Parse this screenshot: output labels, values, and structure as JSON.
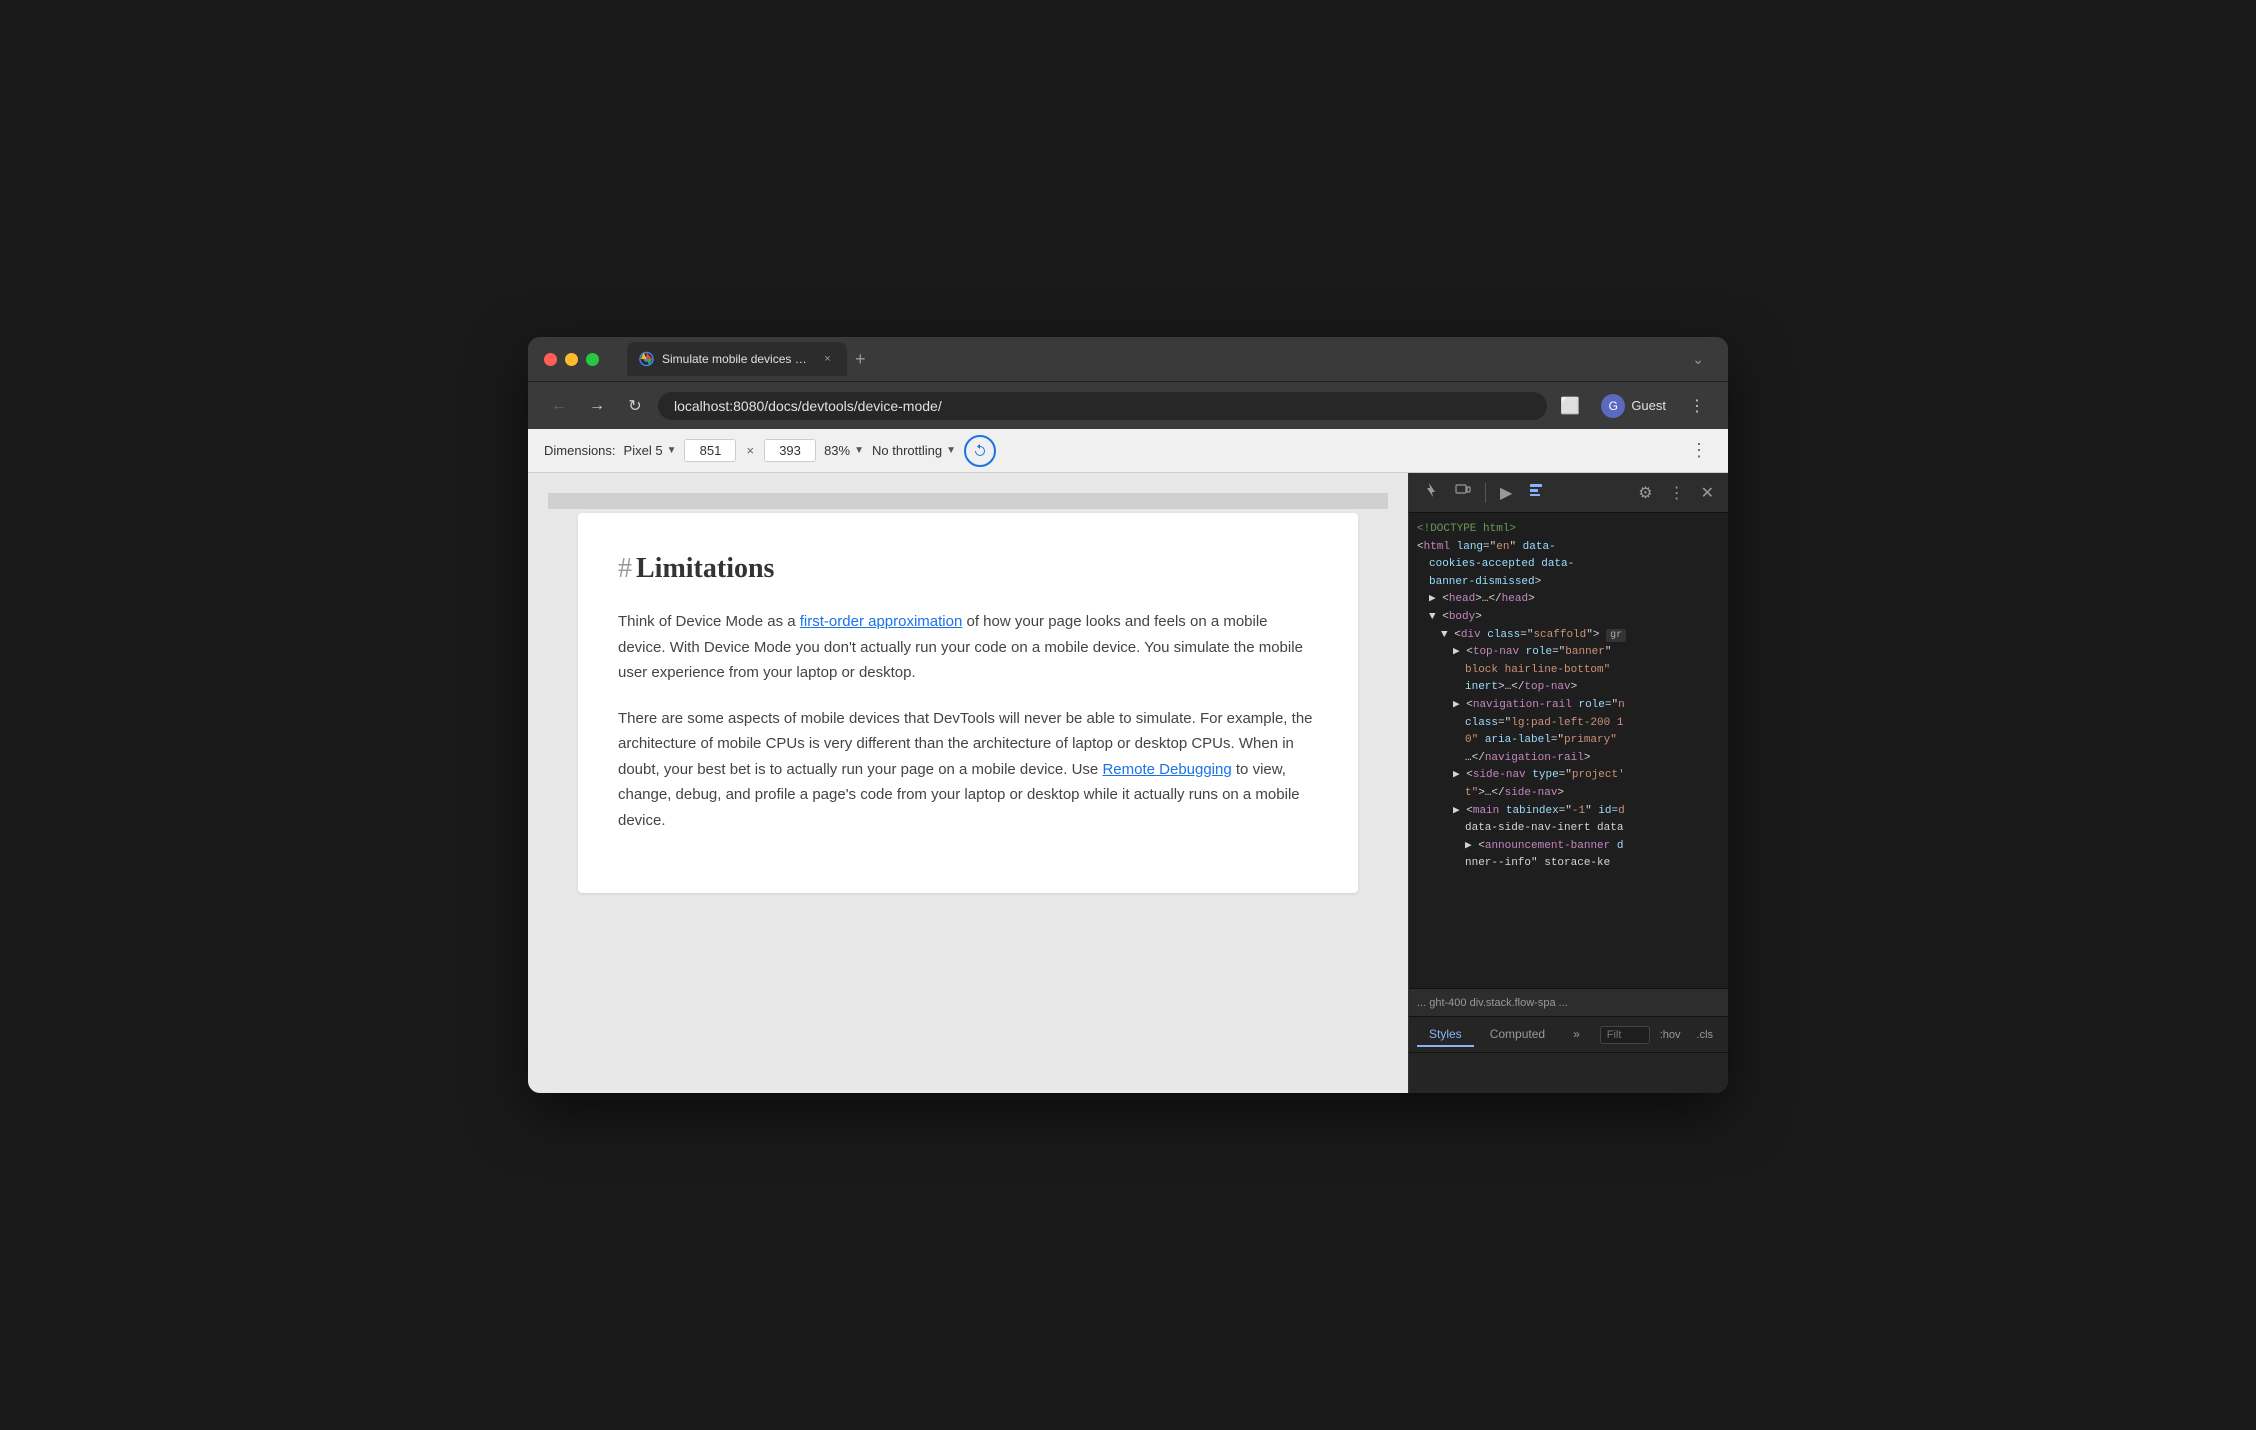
{
  "window": {
    "title": "Simulate mobile devices with D",
    "url": "localhost:8080/docs/devtools/device-mode/"
  },
  "traffic_lights": {
    "close": "close",
    "minimize": "minimize",
    "maximize": "maximize"
  },
  "tab": {
    "title": "Simulate mobile devices with D",
    "close_label": "×"
  },
  "new_tab_label": "+",
  "nav": {
    "back_label": "←",
    "forward_label": "→",
    "reload_label": "↻",
    "address": "localhost:8080/docs/devtools/device-mode/",
    "cast_label": "⬜",
    "profile_label": "Guest",
    "more_label": "⋮"
  },
  "device_toolbar": {
    "dimensions_label": "Dimensions:",
    "device_name": "Pixel 5",
    "width": "851",
    "height": "393",
    "zoom": "83%",
    "throttle": "No throttling",
    "rotate_label": "⤢",
    "more_label": "⋮"
  },
  "page": {
    "heading_hash": "#",
    "heading": "Limitations",
    "paragraph1_before_link": "Think of Device Mode as a ",
    "paragraph1_link": "first-order approximation",
    "paragraph1_after_link": " of how your page looks and feels on a mobile device. With Device Mode you don't actually run your code on a mobile device. You simulate the mobile user experience from your laptop or desktop.",
    "paragraph2_before_link": "There are some aspects of mobile devices that DevTools will never be able to simulate. For example, the architecture of mobile CPUs is very different than the architecture of laptop or desktop CPUs. When in doubt, your best bet is to actually run your page on a mobile device. Use ",
    "paragraph2_link": "Remote Debugging",
    "paragraph2_after_link": " to view, change, debug, and profile a page's code from your laptop or desktop while it actually runs on a mobile device."
  },
  "devtools": {
    "toolbar": {
      "inspect_label": "⬚",
      "device_label": "⧉",
      "console_label": "▶",
      "elements_label": "❑",
      "settings_label": "⚙",
      "more_label": "⋮",
      "close_label": "✕"
    },
    "html": [
      {
        "indent": 0,
        "content": "<!DOCTYPE html>",
        "type": "comment"
      },
      {
        "indent": 0,
        "content_parts": [
          {
            "type": "punct",
            "text": "<"
          },
          {
            "type": "tag",
            "text": "html"
          },
          {
            "type": "attr_name",
            "text": " lang"
          },
          {
            "type": "punct",
            "text": "="
          },
          {
            "type": "attr_val",
            "text": "\"en\""
          },
          {
            "type": "attr_name",
            "text": " data-cookies-accepted"
          },
          {
            "type": "attr_name",
            "text": " data-banner-dismissed"
          },
          {
            "type": "punct",
            "text": ">"
          }
        ]
      },
      {
        "indent": 1,
        "content_parts": [
          {
            "type": "expand",
            "text": "▶"
          },
          {
            "type": "punct",
            "text": "<"
          },
          {
            "type": "tag",
            "text": "head"
          },
          {
            "type": "punct",
            "text": ">…</"
          },
          {
            "type": "tag",
            "text": "head"
          },
          {
            "type": "punct",
            "text": ">"
          }
        ]
      },
      {
        "indent": 1,
        "content_parts": [
          {
            "type": "expand",
            "text": "▼"
          },
          {
            "type": "punct",
            "text": "<"
          },
          {
            "type": "tag",
            "text": "body"
          },
          {
            "type": "punct",
            "text": ">"
          }
        ]
      },
      {
        "indent": 2,
        "content_parts": [
          {
            "type": "expand",
            "text": "▼"
          },
          {
            "type": "punct",
            "text": "<"
          },
          {
            "type": "tag",
            "text": "div"
          },
          {
            "type": "attr_name",
            "text": " class"
          },
          {
            "type": "punct",
            "text": "="
          },
          {
            "type": "attr_val",
            "text": "\"scaffold\""
          },
          {
            "type": "punct",
            "text": ">"
          },
          {
            "type": "attr_val",
            "text": "gr"
          }
        ]
      },
      {
        "indent": 3,
        "content_parts": [
          {
            "type": "expand",
            "text": "▶"
          },
          {
            "type": "punct",
            "text": "<"
          },
          {
            "type": "tag",
            "text": "top-nav"
          },
          {
            "type": "attr_name",
            "text": " role"
          },
          {
            "type": "punct",
            "text": "="
          },
          {
            "type": "attr_val",
            "text": "\"banner\""
          },
          {
            "type": "attr_name",
            "text": " "
          }
        ]
      },
      {
        "indent": 4,
        "content_parts": [
          {
            "type": "plain",
            "text": "block hairline-bottom\""
          },
          {
            "type": "attr_name",
            "text": " "
          }
        ]
      },
      {
        "indent": 4,
        "content_parts": [
          {
            "type": "plain",
            "text": "inert>…</"
          },
          {
            "type": "tag",
            "text": "top-nav"
          },
          {
            "type": "punct",
            "text": ">"
          }
        ]
      },
      {
        "indent": 3,
        "content_parts": [
          {
            "type": "expand",
            "text": "▶"
          },
          {
            "type": "punct",
            "text": "<"
          },
          {
            "type": "tag",
            "text": "navigation-rail"
          },
          {
            "type": "attr_name",
            "text": " role"
          },
          {
            "type": "punct",
            "text": "="
          },
          {
            "type": "attr_val",
            "text": "\"n"
          }
        ]
      },
      {
        "indent": 4,
        "content_parts": [
          {
            "type": "attr_name",
            "text": "class"
          },
          {
            "type": "punct",
            "text": "="
          },
          {
            "type": "attr_val",
            "text": "\"lg:pad-left-200 1"
          }
        ]
      },
      {
        "indent": 4,
        "content_parts": [
          {
            "type": "plain",
            "text": "0\""
          },
          {
            "type": "attr_name",
            "text": " aria-label"
          },
          {
            "type": "punct",
            "text": "="
          },
          {
            "type": "attr_val",
            "text": "\"primary\""
          }
        ]
      },
      {
        "indent": 4,
        "content_parts": [
          {
            "type": "plain",
            "text": "…</"
          },
          {
            "type": "tag",
            "text": "navigation-rail"
          },
          {
            "type": "punct",
            "text": ">"
          }
        ]
      },
      {
        "indent": 3,
        "content_parts": [
          {
            "type": "expand",
            "text": "▶"
          },
          {
            "type": "punct",
            "text": "<"
          },
          {
            "type": "tag",
            "text": "side-nav"
          },
          {
            "type": "attr_name",
            "text": " type"
          },
          {
            "type": "punct",
            "text": "="
          },
          {
            "type": "attr_val",
            "text": "\"project'"
          }
        ]
      },
      {
        "indent": 4,
        "content_parts": [
          {
            "type": "plain",
            "text": "t\">…</"
          },
          {
            "type": "tag",
            "text": "side-nav"
          },
          {
            "type": "punct",
            "text": ">"
          }
        ]
      },
      {
        "indent": 3,
        "content_parts": [
          {
            "type": "expand",
            "text": "▶"
          },
          {
            "type": "punct",
            "text": "<"
          },
          {
            "type": "tag",
            "text": "main"
          },
          {
            "type": "attr_name",
            "text": " tabindex"
          },
          {
            "type": "punct",
            "text": "="
          },
          {
            "type": "attr_val",
            "text": "\"-1\""
          },
          {
            "type": "attr_name",
            "text": " id="
          },
          {
            "type": "attr_val",
            "text": "d"
          }
        ]
      },
      {
        "indent": 4,
        "content_parts": [
          {
            "type": "plain",
            "text": "data-side-nav-inert data"
          }
        ]
      },
      {
        "indent": 4,
        "content_parts": [
          {
            "type": "expand",
            "text": "▶"
          },
          {
            "type": "punct",
            "text": "<"
          },
          {
            "type": "tag",
            "text": "announcement-banner"
          },
          {
            "type": "attr_name",
            "text": " d"
          }
        ]
      },
      {
        "indent": 4,
        "content_parts": [
          {
            "type": "plain",
            "text": "nner--info\" storace-ke"
          }
        ]
      }
    ],
    "status_bar": "... ght-400  div.stack.flow-spa  ...",
    "bottom": {
      "tabs": [
        "Styles",
        "Computed"
      ],
      "active_tab": "Styles",
      "more_label": "»",
      "filter_placeholder": "Filt",
      "hov_label": ":hov",
      "cls_label": ".cls",
      "add_label": "+",
      "toggle_label": "⊡",
      "sidebar_label": "◁"
    }
  }
}
